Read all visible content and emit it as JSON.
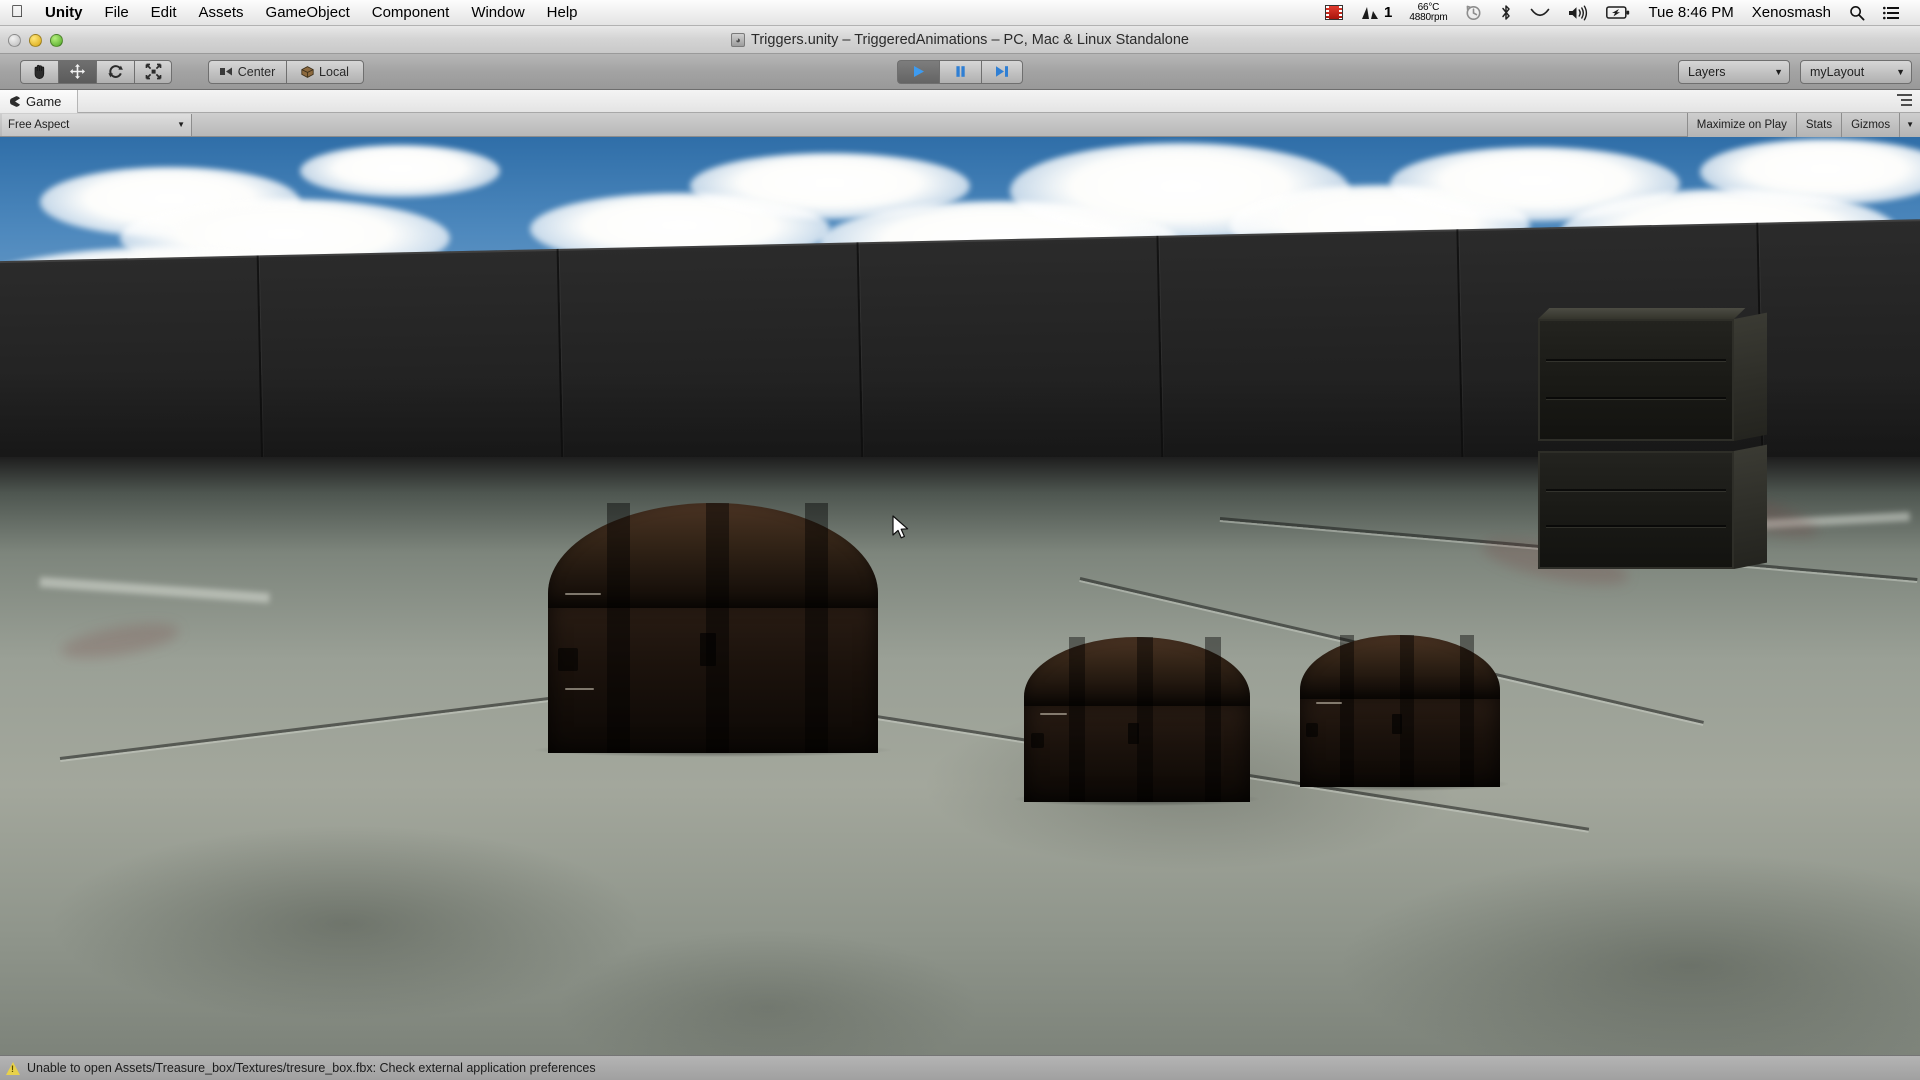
{
  "menubar": {
    "apple_icon": "apple-logo-icon",
    "items": [
      {
        "label": "Unity",
        "bold": true
      },
      {
        "label": "File"
      },
      {
        "label": "Edit"
      },
      {
        "label": "Assets"
      },
      {
        "label": "GameObject"
      },
      {
        "label": "Component"
      },
      {
        "label": "Window"
      },
      {
        "label": "Help"
      }
    ],
    "status": {
      "film_icon": "film-strip-icon",
      "istat_icon": "istat-menus-graph-icon",
      "istat_value": "1",
      "temperature": "66°C",
      "fan_speed": "4880rpm",
      "time_machine_icon": "time-machine-icon",
      "bluetooth_icon": "bluetooth-icon",
      "wifi_icon": "wifi-icon",
      "volume_icon": "volume-icon",
      "battery_icon": "battery-icon",
      "clock": "Tue 8:46 PM",
      "user": "Xenosmash",
      "search_icon": "spotlight-search-icon",
      "notification_icon": "notification-center-icon"
    }
  },
  "window": {
    "title": "Triggers.unity – TriggeredAnimations – PC, Mac & Linux Standalone",
    "doc_icon": "unity-document-icon",
    "traffic": {
      "close_label": "close-button",
      "minimize_label": "minimize-button",
      "zoom_label": "zoom-button"
    }
  },
  "toolbar": {
    "tools": [
      {
        "name": "hand-tool",
        "icon": "hand-icon",
        "active": false
      },
      {
        "name": "move-tool",
        "icon": "move-arrows-icon",
        "active": true
      },
      {
        "name": "rotate-tool",
        "icon": "rotate-icon",
        "active": false
      },
      {
        "name": "scale-tool",
        "icon": "scale-icon",
        "active": false
      }
    ],
    "pivot_mode": "Center",
    "pivot_rotation": "Local",
    "play_label": "play-button",
    "pause_label": "pause-button",
    "step_label": "step-button",
    "play_active": true,
    "layers_label": "Layers",
    "layout_label": "myLayout"
  },
  "panel": {
    "tab_label": "Game",
    "tab_icon": "pacman-game-icon",
    "menu_icon": "panel-options-icon",
    "aspect_ratio": "Free Aspect",
    "maximize_on_play": "Maximize on Play",
    "stats": "Stats",
    "gizmos": "Gizmos"
  },
  "statusbar": {
    "warning_icon": "warning-triangle-icon",
    "message": "Unable to open Assets/Treasure_box/Textures/tresure_box.fbx: Check external application preferences"
  },
  "scene": {
    "description": "Unity Game view: daylight skybox with clouds over a dark concrete wall, mottled gray-green concrete floor, three dark wooden treasure chests and two stacked crates",
    "colors": {
      "sky_top": "#2f6ea8",
      "sky_horizon": "#dfe6ea",
      "cloud": "#ffffff",
      "wall": "#232323",
      "ground": "#a3a79c",
      "chest": "#1b120c",
      "crate": "#1a1a16"
    },
    "cursor_icon": "mouse-pointer-icon"
  }
}
